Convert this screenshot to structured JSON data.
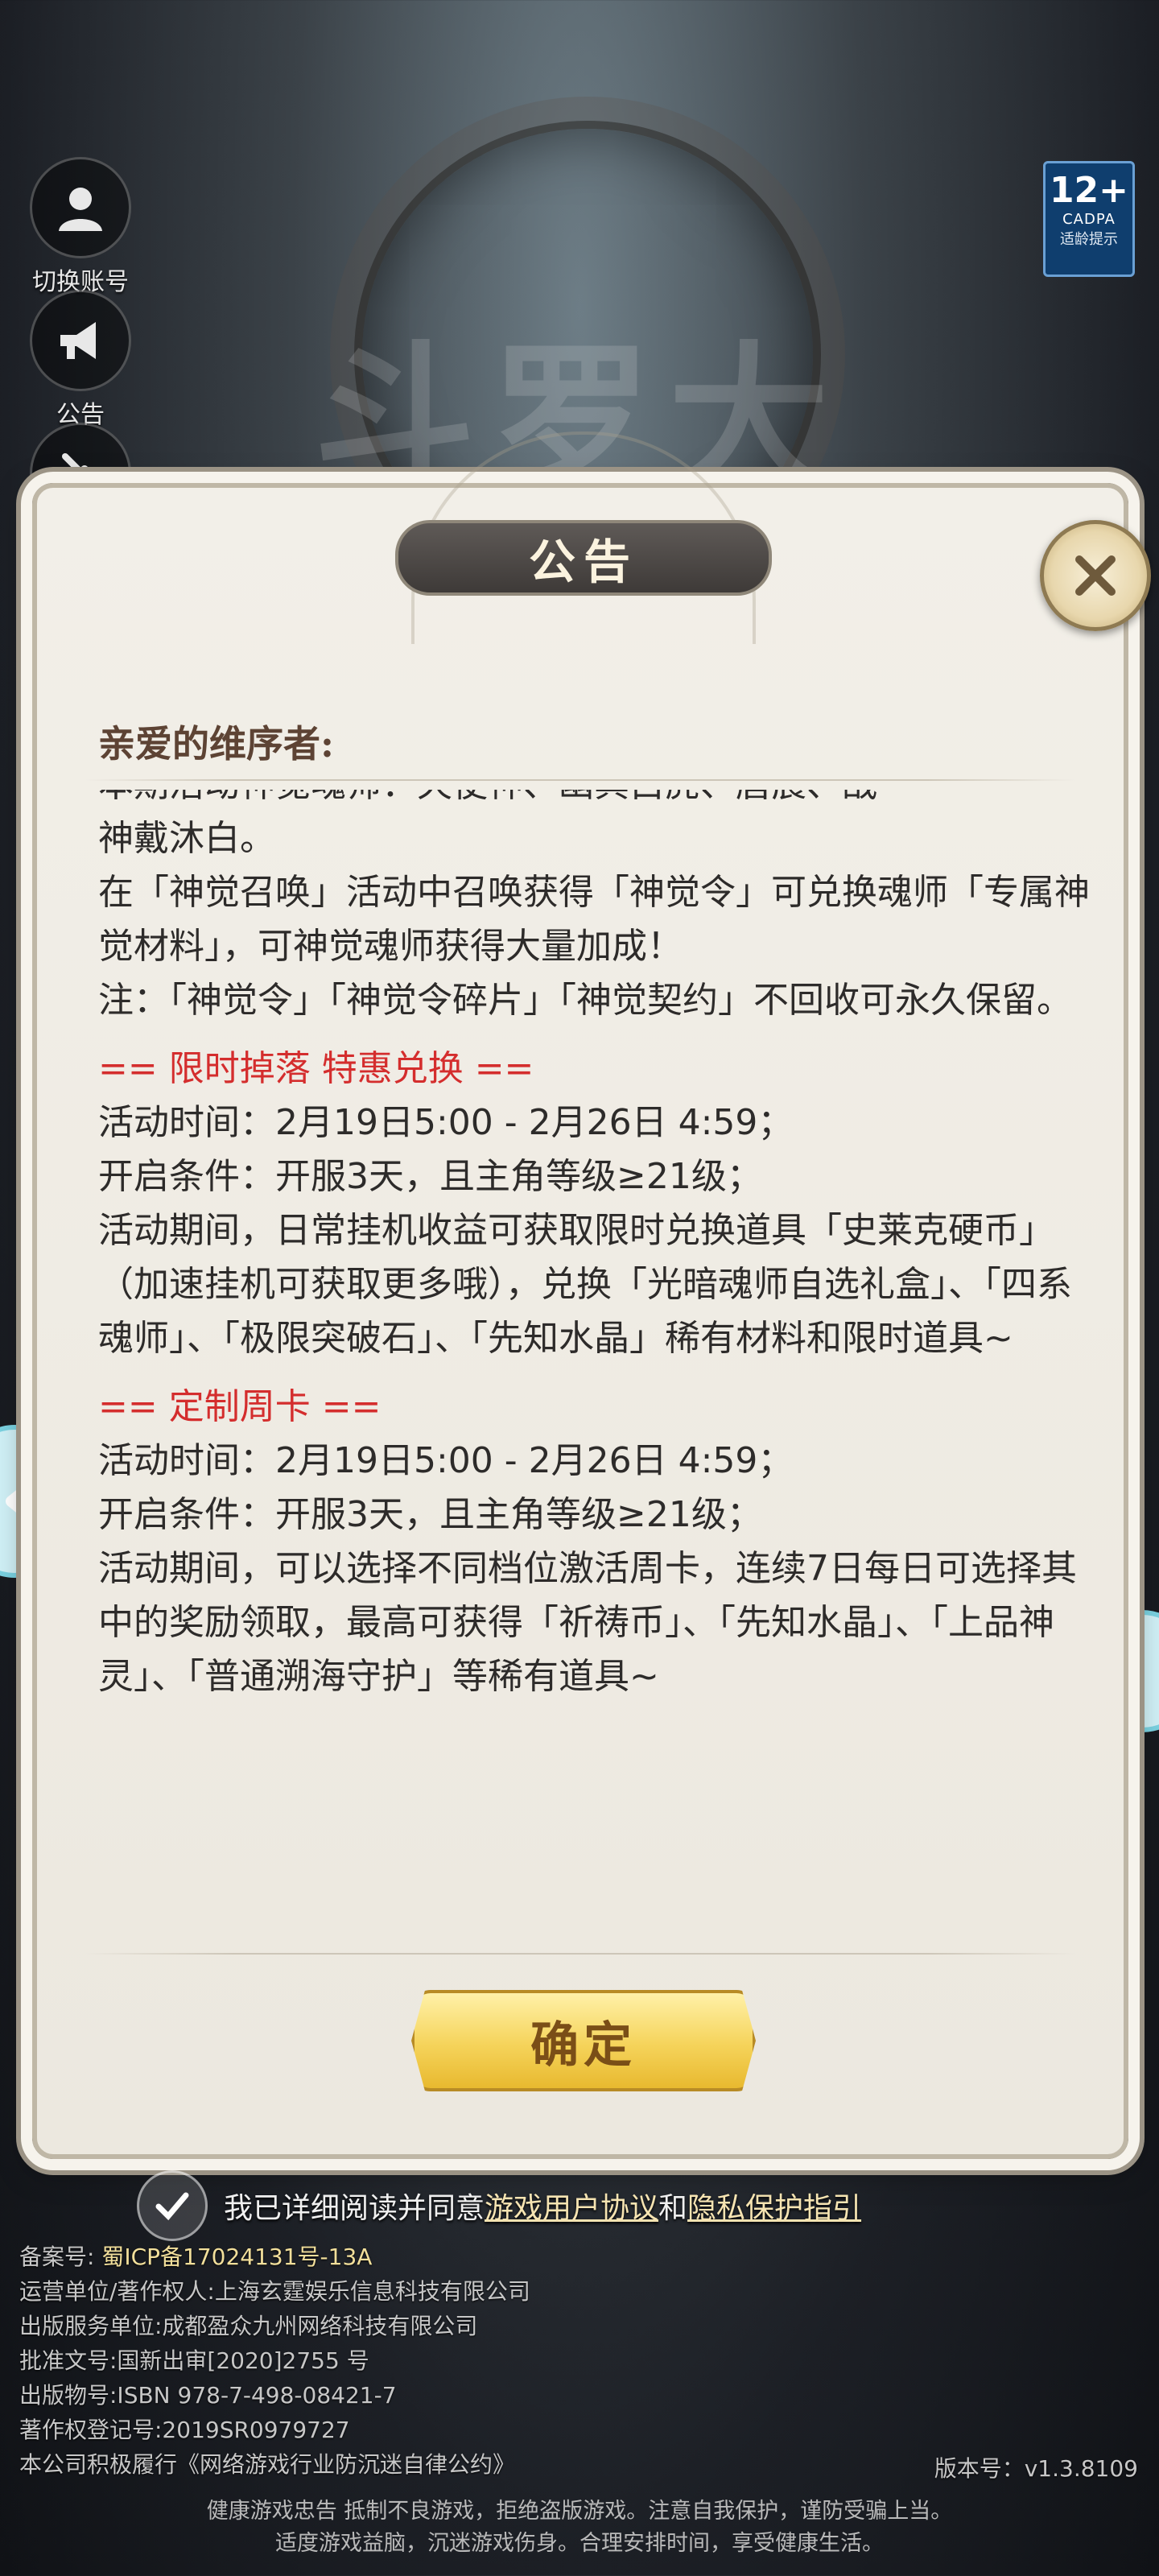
{
  "background": {
    "game_title": "斗罗大陆"
  },
  "age_badge": {
    "age": "12+",
    "org": "CADPA",
    "tip": "适龄提示"
  },
  "side_buttons": [
    {
      "label": "切换账号"
    },
    {
      "label": "公告"
    },
    {
      "label": "修"
    }
  ],
  "dialog": {
    "title": "公告",
    "greeting": "亲爱的维序者:",
    "lines": {
      "cut": "本期活动神觉魂师：天使神、幽冥白虎、唐晨、战",
      "l1": "神戴沐白。",
      "l2": "在「神觉召唤」活动中召唤获得「神觉令」可兑换魂师「专属神觉材料」，可神觉魂师获得大量加成！",
      "l3": "注：「神觉令」「神觉令碎片」「神觉契约」不回收可永久保留。"
    },
    "sections": [
      {
        "heading": "== 限时掉落 特惠兑换 ==",
        "time": "活动时间：2月19日5:00 - 2月26日 4:59；",
        "condition": "开启条件：开服3天，且主角等级≥21级；",
        "desc": "活动期间，日常挂机收益可获取限时兑换道具「史莱克硬币」（加速挂机可获取更多哦），兑换「光暗魂师自选礼盒」、「四系魂师」、「极限突破石」、「先知水晶」稀有材料和限时道具~"
      },
      {
        "heading": "== 定制周卡 ==",
        "time": "活动时间：2月19日5:00 - 2月26日 4:59；",
        "condition": "开启条件：开服3天，且主角等级≥21级；",
        "desc": "活动期间，可以选择不同档位激活周卡，连续7日每日可选择其中的奖励领取，最高可获得「祈祷币」、「先知水晶」、「上品神灵」、「普通溯海守护」等稀有道具~"
      }
    ],
    "confirm_label": "确定"
  },
  "agreement": {
    "prefix": "我已详细阅读并同意",
    "link1": "游戏用户协议",
    "and": "和",
    "link2": "隐私保护指引"
  },
  "legal": {
    "icp_label": "备案号:",
    "icp_value": "蜀ICP备17024131号-13A",
    "operator": "运营单位/著作权人:上海玄霆娱乐信息科技有限公司",
    "publisher": "出版服务单位:成都盈众九州网络科技有限公司",
    "approval": "批准文号:国新出审[2020]2755 号",
    "isbn": "出版物号:ISBN 978-7-498-08421-7",
    "copyright": "著作权登记号:2019SR0979727",
    "pledge": "本公司积极履行《网络游戏行业防沉迷自律公约》",
    "version": "版本号：v1.3.8109"
  },
  "health_notice": {
    "line1": "健康游戏忠告   抵制不良游戏，拒绝盗版游戏。注意自我保护，谨防受骗上当。",
    "line2": "适度游戏益脑，沉迷游戏伤身。合理安排时间，享受健康生活。"
  },
  "colors": {
    "section_heading": "#d42d2d",
    "confirm_gold": "#f5d35a",
    "dialog_bg": "#f2efe8"
  }
}
